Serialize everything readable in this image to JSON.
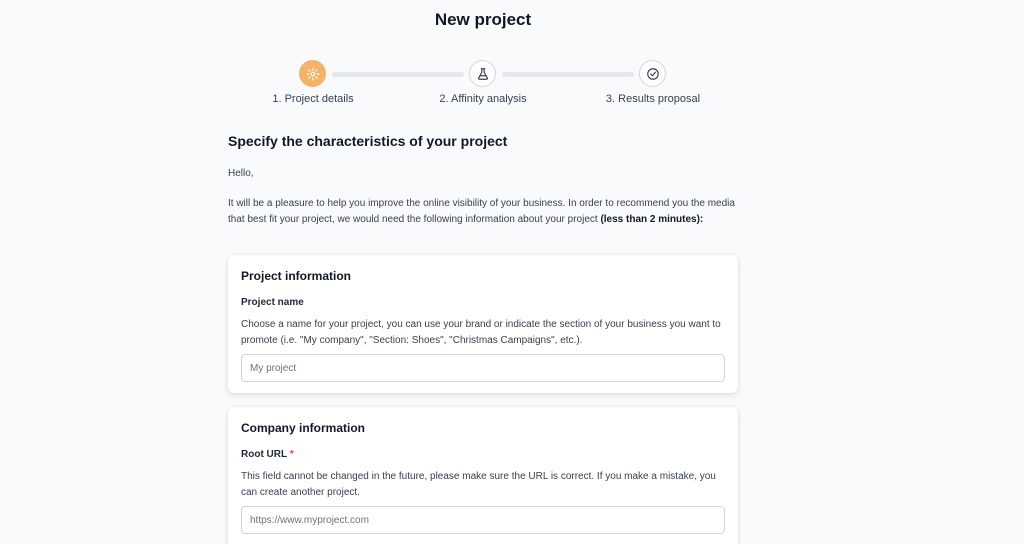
{
  "page": {
    "title": "New project"
  },
  "stepper": {
    "active_color": "#f4b366",
    "steps": [
      {
        "label": "1. Project details",
        "icon": "gear-icon",
        "active": true
      },
      {
        "label": "2. Affinity analysis",
        "icon": "flask-icon",
        "active": false
      },
      {
        "label": "3. Results proposal",
        "icon": "check-circle-icon",
        "active": false
      }
    ]
  },
  "intro": {
    "heading": "Specify the characteristics of your project",
    "greeting": "Hello,",
    "text": "It will be a pleasure to help you improve the online visibility of your business. In order to recommend you the media that best fit your project, we would need the following information about your project ",
    "emphasis": "(less than 2 minutes)",
    "suffix": ":"
  },
  "project_info": {
    "title": "Project information",
    "name_label": "Project name",
    "name_help": "Choose a name for your project, you can use your brand or indicate the section of your business you want to promote (i.e. \"My company\", \"Section: Shoes\", \"Christmas Campaigns\", etc.).",
    "name_placeholder": "My project",
    "name_value": ""
  },
  "company_info": {
    "title": "Company information",
    "url_label": "Root URL",
    "required_mark": "*",
    "url_help": "This field cannot be changed in the future, please make sure the URL is correct. If you make a mistake, you can create another project.",
    "url_placeholder": "https://www.myproject.com",
    "url_value": ""
  }
}
